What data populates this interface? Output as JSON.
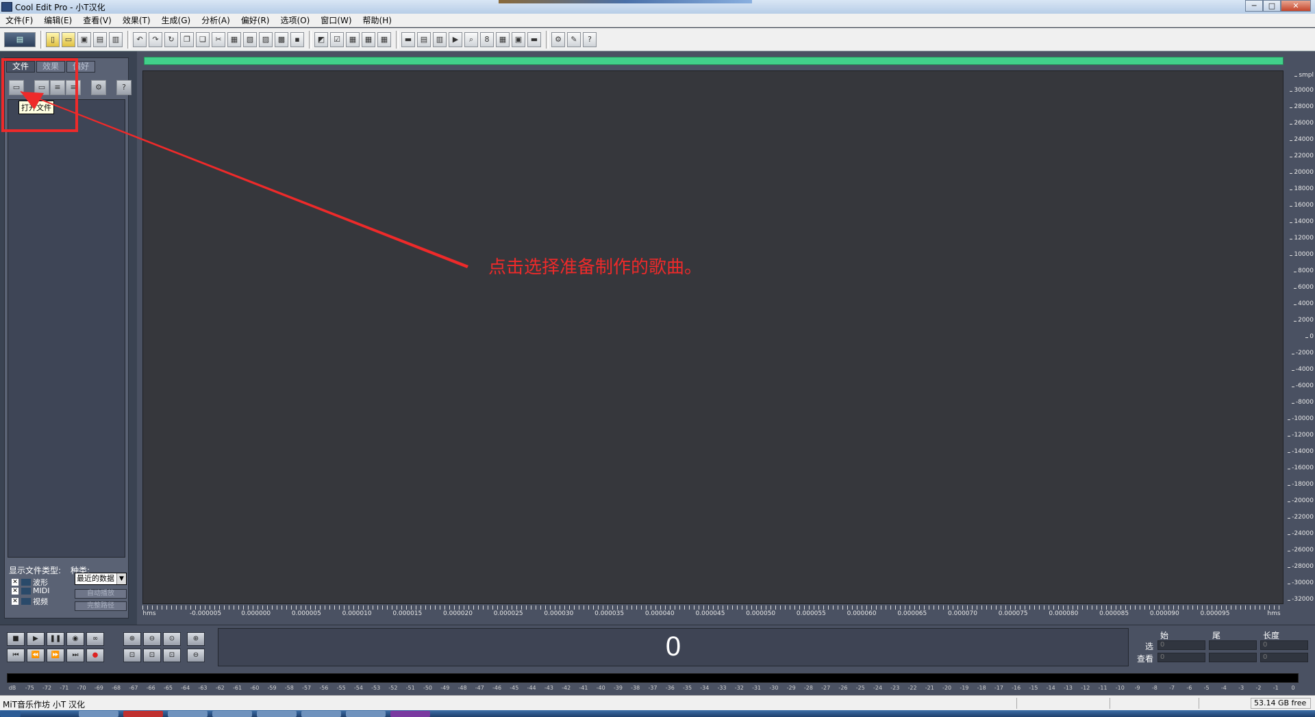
{
  "window": {
    "title": "Cool Edit Pro  - 小T汉化",
    "controls": [
      "─",
      "□",
      "✕"
    ]
  },
  "menu": [
    "文件(F)",
    "编辑(E)",
    "查看(V)",
    "效果(T)",
    "生成(G)",
    "分析(A)",
    "偏好(R)",
    "选项(O)",
    "窗口(W)",
    "帮助(H)"
  ],
  "left_panel": {
    "tabs": [
      "文件",
      "效果",
      "偏好"
    ],
    "tooltip": "打开文件",
    "file_types_label": "显示文件类型:",
    "kind_label": "种类:",
    "types": [
      {
        "check": "✕",
        "label": "波形"
      },
      {
        "check": "✕",
        "label": "MIDI"
      },
      {
        "check": "✕",
        "label": "视频"
      }
    ],
    "kind_select": "最近的数据",
    "auto_play": "自动播放",
    "full_path": "完整路径"
  },
  "annotation": "点击选择准备制作的歌曲。",
  "y_axis": {
    "unit": "smpl",
    "ticks": [
      "30000",
      "28000",
      "26000",
      "24000",
      "22000",
      "20000",
      "18000",
      "16000",
      "14000",
      "12000",
      "10000",
      "8000",
      "6000",
      "4000",
      "2000",
      "0",
      "-2000",
      "-4000",
      "-6000",
      "-8000",
      "-10000",
      "-12000",
      "-14000",
      "-16000",
      "-18000",
      "-20000",
      "-22000",
      "-24000",
      "-26000",
      "-28000",
      "-30000",
      "-32000"
    ]
  },
  "x_axis": {
    "unit_left": "hms",
    "unit_right": "hms",
    "ticks": [
      "-0.000005",
      "0.000000",
      "0.000005",
      "0.000010",
      "0.000015",
      "0.000020",
      "0.000025",
      "0.000030",
      "0.000035",
      "0.000040",
      "0.000045",
      "0.000050",
      "0.000055",
      "0.000060",
      "0.000065",
      "0.000070",
      "0.000075",
      "0.000080",
      "0.000085",
      "0.000090",
      "0.000095"
    ]
  },
  "time_display": "0",
  "selection": {
    "headers": [
      "始",
      "尾",
      "长度"
    ],
    "rows": [
      {
        "label": "选",
        "values": [
          "0",
          "",
          "0"
        ]
      },
      {
        "label": "查看",
        "values": [
          "0",
          "",
          "0"
        ]
      }
    ]
  },
  "meter_scale": [
    "dB",
    "-75",
    "-72",
    "-71",
    "-70",
    "-69",
    "-68",
    "-67",
    "-66",
    "-65",
    "-64",
    "-63",
    "-62",
    "-61",
    "-60",
    "-59",
    "-58",
    "-57",
    "-56",
    "-55",
    "-54",
    "-53",
    "-52",
    "-51",
    "-50",
    "-49",
    "-48",
    "-47",
    "-46",
    "-45",
    "-44",
    "-43",
    "-42",
    "-41",
    "-40",
    "-39",
    "-38",
    "-37",
    "-36",
    "-35",
    "-34",
    "-33",
    "-32",
    "-31",
    "-30",
    "-29",
    "-28",
    "-27",
    "-26",
    "-25",
    "-24",
    "-23",
    "-22",
    "-21",
    "-20",
    "-19",
    "-18",
    "-17",
    "-16",
    "-15",
    "-14",
    "-13",
    "-12",
    "-11",
    "-10",
    "-9",
    "-8",
    "-7",
    "-6",
    "-5",
    "-4",
    "-3",
    "-2",
    "-1",
    "0"
  ],
  "status": {
    "text": "MiT音乐作坊 小T 汉化",
    "free_space": "53.14 GB free"
  },
  "colors": {
    "annotation": "#ee2a2a",
    "overview": "#41d08a",
    "waveform_bg": "#36373c"
  }
}
